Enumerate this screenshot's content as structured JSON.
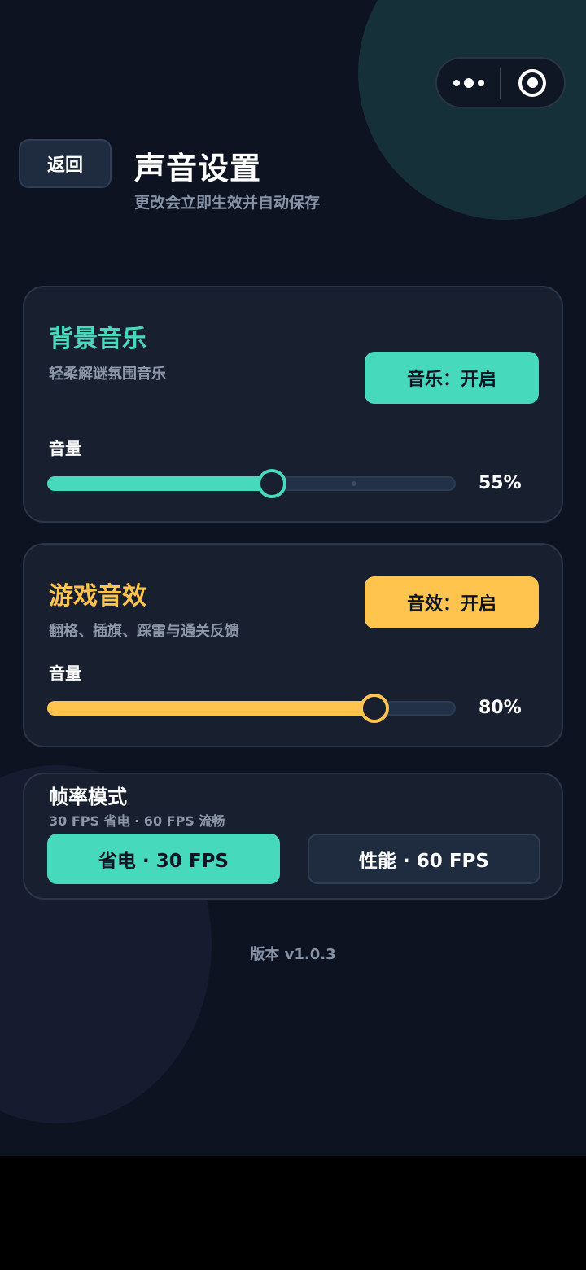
{
  "header": {
    "back_label": "返回",
    "title": "声音设置",
    "subtitle": "更改会立即生效并自动保存"
  },
  "music": {
    "title": "背景音乐",
    "desc": "轻柔解谜氛围音乐",
    "toggle_label": "音乐：开启",
    "volume_label": "音量",
    "volume_value": 55,
    "volume_text": "55%",
    "accent": "#46d9bc"
  },
  "sfx": {
    "title": "游戏音效",
    "desc": "翻格、插旗、踩雷与通关反馈",
    "toggle_label": "音效：开启",
    "volume_label": "音量",
    "volume_value": 80,
    "volume_text": "80%",
    "accent": "#ffc44d"
  },
  "fps": {
    "title": "帧率模式",
    "desc": "30 FPS 省电 · 60 FPS 流畅",
    "option_low": "省电 · 30 FPS",
    "option_high": "性能 · 60 FPS",
    "selected": "low"
  },
  "footer": {
    "version": "版本  v1.0.3"
  },
  "capsule": {
    "more_icon": "more-dots-icon",
    "close_icon": "target-circle-icon"
  }
}
